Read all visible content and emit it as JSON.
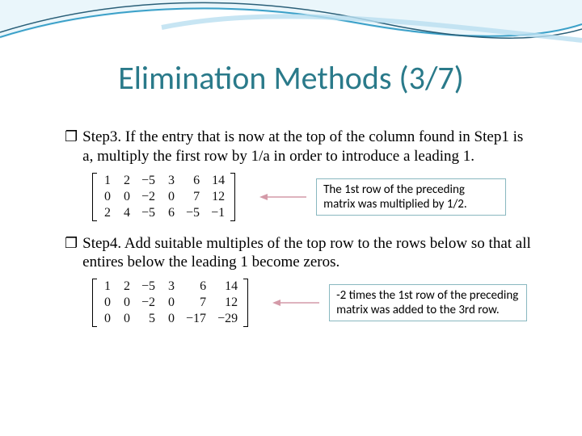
{
  "title": "Elimination Methods (3/7)",
  "bullets": {
    "step3": "Step3. If the entry that is now at the top of the column found in Step1 is a, multiply the first row by 1/a in order to introduce a leading 1.",
    "step4": "Step4. Add suitable multiples of the top row to the rows below so that all entires below the leading 1 become zeros."
  },
  "matrices": {
    "m1": [
      [
        "1",
        "2",
        "−5",
        "3",
        "6",
        "14"
      ],
      [
        "0",
        "0",
        "−2",
        "0",
        "7",
        "12"
      ],
      [
        "2",
        "4",
        "−5",
        "6",
        "−5",
        "−1"
      ]
    ],
    "m2": [
      [
        "1",
        "2",
        "−5",
        "3",
        "6",
        "14"
      ],
      [
        "0",
        "0",
        "−2",
        "0",
        "7",
        "12"
      ],
      [
        "0",
        "0",
        "5",
        "0",
        "−17",
        "−29"
      ]
    ]
  },
  "notes": {
    "n1": "The 1st row of the preceding matrix was multiplied by 1/2.",
    "n2": "-2 times the 1st row of the preceding matrix was added to the 3rd row."
  }
}
